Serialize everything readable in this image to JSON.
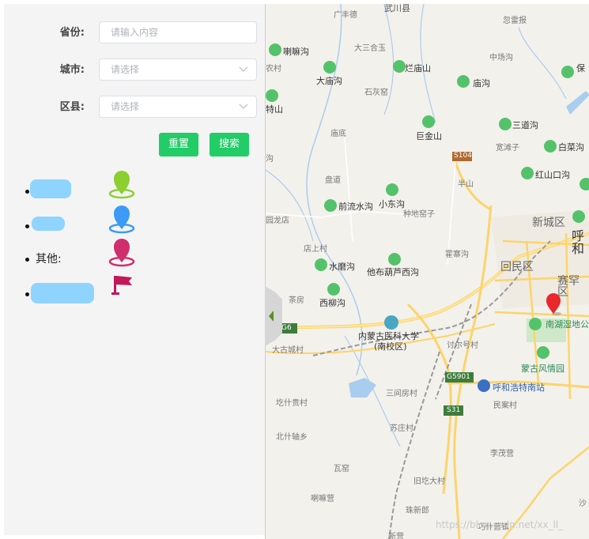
{
  "form": {
    "province_label": "省份:",
    "province_placeholder": "请输入内容",
    "city_label": "城市:",
    "city_placeholder": "请选择",
    "district_label": "区县:",
    "district_placeholder": "请选择",
    "reset_label": "重置",
    "search_label": "搜索"
  },
  "legend": {
    "other_label": "其他:",
    "colors": {
      "green": "#8ccf2f",
      "blue": "#3b9bf5",
      "magenta": "#d12e6e",
      "flag": "#c2185b"
    }
  },
  "map": {
    "labels": {
      "guangshide": "广丰德",
      "wuchuanxian": "武川县",
      "hudianmiao": "忽雷报",
      "lalagou": "喇嘛沟",
      "dasanhe": "大三合玉",
      "lanmiaoshan": "烂庙山",
      "zhonggougou": "中场沟",
      "baoxian": "保",
      "nongcun": "农村",
      "damiaogou": "大庙沟",
      "miaogou": "庙沟",
      "shihuiyao": "石灰窑",
      "teshan": "特山",
      "miaodi": "庙底",
      "jujinshan": "巨金山",
      "sandaogou": "三道沟",
      "baiquangou": "白菜沟",
      "kuantanzi": "宽滩子",
      "gou": "沟",
      "s104": "S104",
      "hongshankougou": "红山口沟",
      "pandao": "盘道",
      "banshan": "半山",
      "xiaodonggou": "小东沟",
      "qianliushuigou": "前流水沟",
      "zhongdiyaozi": "种地窑子",
      "yuanlongdian": "园龙店",
      "xinchengqu": "新城区",
      "hu": "呼和",
      "dianshangcun": "店上村",
      "huozhaigou": "霍寨沟",
      "huiminqu": "回民区",
      "shuimogou": "水磨沟",
      "tabuhuluxigou": "他布葫芦西沟",
      "saihanqu": "赛罕区",
      "xiliugou": "西柳沟",
      "chafang": "茶房",
      "imau_line1": "内蒙古医科大学",
      "imau_line2": "(南校区)",
      "nanhu": "南湖湿地公",
      "g6": "G6",
      "dagucheng": "大古城村",
      "taoerhao": "讨尔号村",
      "menggu": "蒙古风情园",
      "g5901": "G5901",
      "hhhtsouth": "呼和浩特南站",
      "sanjianfang": "三间房村",
      "gesiguicun": "圪什贵村",
      "minancun": "民案村",
      "s31": "S31",
      "suzhuangcun": "苏庄村",
      "beishizhou": "北什轴乡",
      "limaoying": "李茂营",
      "wayao": "瓦窑",
      "lamaying": "喇嘛营",
      "jiuhedacun": "旧圪大村",
      "zhuxinglang": "珠新郎",
      "qiaoshiying": "巧什营镇",
      "xinshang": "新营",
      "sha": "沙",
      "watermark": "https://blog.csdn.net/xx_ll_"
    }
  }
}
